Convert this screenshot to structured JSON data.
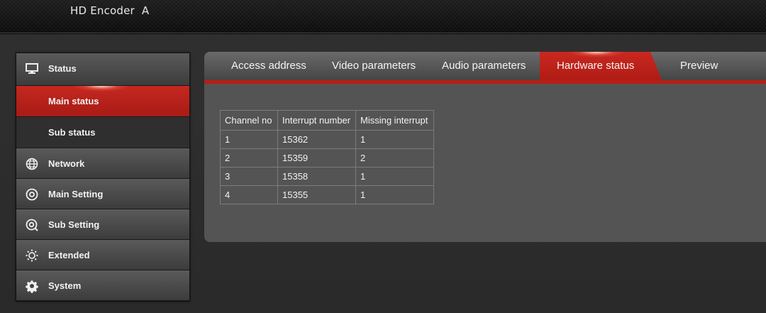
{
  "header": {
    "title": "HD Encoder  A"
  },
  "sidebar": {
    "items": [
      {
        "label": "Status",
        "icon": "monitor-icon"
      },
      {
        "label": "Main status",
        "active": true
      },
      {
        "label": "Sub status"
      },
      {
        "label": "Network",
        "icon": "globe-icon"
      },
      {
        "label": "Main Setting",
        "icon": "target-icon"
      },
      {
        "label": "Sub Setting",
        "icon": "target-search-icon"
      },
      {
        "label": "Extended",
        "icon": "sun-gear-icon"
      },
      {
        "label": "System",
        "icon": "gear-icon"
      }
    ]
  },
  "tabs": [
    {
      "label": "Access address"
    },
    {
      "label": "Video parameters"
    },
    {
      "label": "Audio parameters"
    },
    {
      "label": "Hardware status",
      "active": true
    },
    {
      "label": "Preview"
    }
  ],
  "hardware_table": {
    "columns": [
      "Channel no",
      "Interrupt number",
      "Missing interrupt"
    ],
    "rows": [
      [
        "1",
        "15362",
        "1"
      ],
      [
        "2",
        "15359",
        "2"
      ],
      [
        "3",
        "15358",
        "1"
      ],
      [
        "4",
        "15355",
        "1"
      ]
    ]
  },
  "colors": {
    "accent": "#b91d16",
    "panel": "#545454",
    "background": "#2e2e2e"
  }
}
